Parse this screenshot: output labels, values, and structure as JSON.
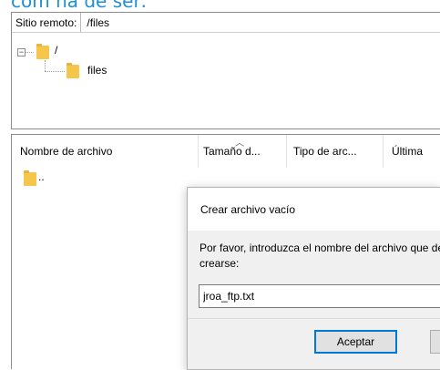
{
  "caption": "com ha de ser:",
  "remote_site": {
    "label": "Sitio remoto:",
    "path": "/files",
    "tree": [
      {
        "name": "/"
      },
      {
        "name": "files"
      }
    ]
  },
  "file_list": {
    "columns": [
      "Nombre de archivo",
      "Tamaño d...",
      "Tipo de arc...",
      "Última"
    ],
    "rows": [
      {
        "name": ".."
      }
    ]
  },
  "dialog": {
    "title": "Crear archivo vacío",
    "prompt_line1": "Por favor, introduzca el nombre del archivo que debería",
    "prompt_line2": "crearse:",
    "input_value": "jroa_ftp.txt",
    "ok_label": "Aceptar"
  }
}
